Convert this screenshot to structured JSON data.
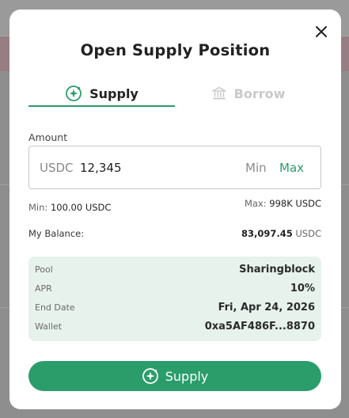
{
  "modal": {
    "title": "Open Supply Position",
    "close_icon": "close-icon"
  },
  "tabs": [
    {
      "label": "Supply",
      "icon": "sparkle-coin-icon",
      "active": true
    },
    {
      "label": "Borrow",
      "icon": "bank-icon",
      "active": false
    }
  ],
  "amount": {
    "label": "Amount",
    "currency": "USDC",
    "value": "12,345",
    "min_label": "Min",
    "max_label": "Max"
  },
  "limits": {
    "min_prefix": "Min:",
    "min_value": "100.00 USDC",
    "max_prefix": "Max:",
    "max_value": "998K USDC"
  },
  "balance": {
    "label": "My Balance:",
    "value": "83,097.45",
    "unit": "USDC"
  },
  "details": [
    {
      "key": "Pool",
      "value": "Sharingblock"
    },
    {
      "key": "APR",
      "value": "10%"
    },
    {
      "key": "End Date",
      "value": "Fri, Apr 24, 2026"
    },
    {
      "key": "Wallet",
      "value": "0xa5AF486F...8870"
    }
  ],
  "submit": {
    "label": "Supply",
    "icon": "sparkle-coin-icon"
  },
  "colors": {
    "accent": "#2a9d6a",
    "card_bg": "#e7f2ec",
    "muted_tab": "#c9c9c9"
  }
}
